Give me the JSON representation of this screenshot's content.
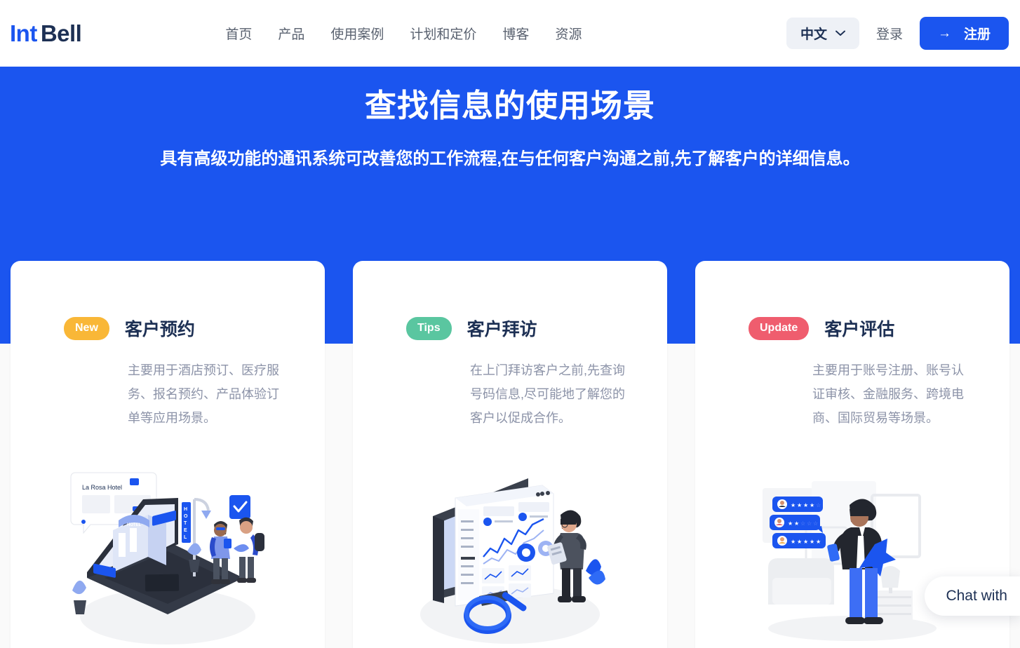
{
  "brand": {
    "part1": "Int",
    "part2": "Bell"
  },
  "nav": {
    "items": [
      {
        "label": "首页"
      },
      {
        "label": "产品"
      },
      {
        "label": "使用案例"
      },
      {
        "label": "计划和定价"
      },
      {
        "label": "博客"
      },
      {
        "label": "资源"
      }
    ]
  },
  "header_actions": {
    "language": "中文",
    "login": "登录",
    "signup": "注册",
    "signup_arrow": "→"
  },
  "hero": {
    "title": "查找信息的使用场景",
    "subtitle": "具有高级功能的通讯系统可改善您的工作流程,在与任何客户沟通之前,先了解客户的详细信息。",
    "background_color": "#1b55ef"
  },
  "cards": [
    {
      "badge": "New",
      "badge_color": "#f9b737",
      "title": "客户预约",
      "description": "主要用于酒店预订、医疗服务、报名预约、产品体验订单等应用场景。",
      "illustration": "hotel-booking-illustration",
      "illustration_text": "La Rosa Hotel"
    },
    {
      "badge": "Tips",
      "badge_color": "#5ac6a0",
      "title": "客户拜访",
      "description": "在上门拜访客户之前,先查询号码信息,尽可能地了解您的客户以促成合作。",
      "illustration": "analytics-dashboard-illustration",
      "illustration_text": ""
    },
    {
      "badge": "Update",
      "badge_color": "#ef5d6e",
      "title": "客户评估",
      "description": "主要用于账号注册、账号认证审核、金融服务、跨境电商、国际贸易等场景。",
      "illustration": "customer-reviews-illustration",
      "illustration_text": ""
    }
  ],
  "chat_widget": {
    "label": "Chat with"
  }
}
